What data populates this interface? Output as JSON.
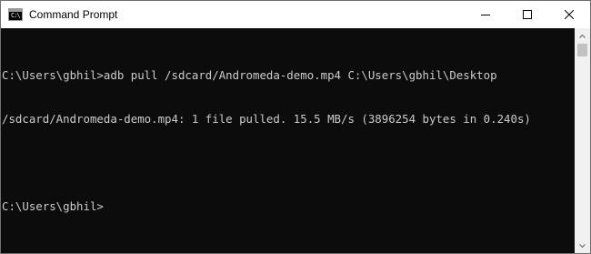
{
  "window": {
    "title": "Command Prompt",
    "icon": "console-icon",
    "icon_glyph": "C:\\"
  },
  "controls": {
    "minimize_icon": "minimize-icon",
    "maximize_icon": "maximize-icon",
    "close_icon": "close-icon"
  },
  "console": {
    "background": "#0c0c0c",
    "foreground": "#cccccc",
    "lines": [
      "C:\\Users\\gbhil>adb pull /sdcard/Andromeda-demo.mp4 C:\\Users\\gbhil\\Desktop",
      "/sdcard/Andromeda-demo.mp4: 1 file pulled. 15.5 MB/s (3896254 bytes in 0.240s)",
      "",
      "C:\\Users\\gbhil>"
    ]
  },
  "scrollbar": {
    "up_icon": "scroll-up-arrow-icon",
    "down_icon": "scroll-down-arrow-icon"
  }
}
